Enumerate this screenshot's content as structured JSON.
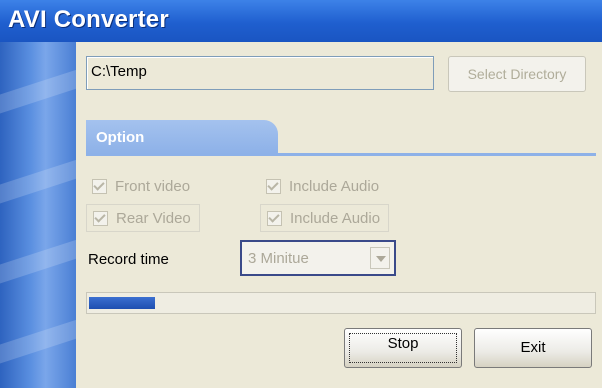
{
  "window": {
    "title": "AVI Converter"
  },
  "directory": {
    "value": "C:\\Temp",
    "select_label": "Select Directory"
  },
  "tab": {
    "label": "Option"
  },
  "options": {
    "front_video": {
      "label": "Front video",
      "checked": true,
      "enabled": false
    },
    "front_audio": {
      "label": "Include Audio",
      "checked": true,
      "enabled": false
    },
    "rear_video": {
      "label": "Rear Video",
      "checked": true,
      "enabled": false
    },
    "rear_audio": {
      "label": "Include Audio",
      "checked": true,
      "enabled": false
    }
  },
  "record_time": {
    "label": "Record time",
    "value": "3 Minitue"
  },
  "progress": {
    "fraction": 0.13
  },
  "buttons": {
    "stop": "Stop",
    "exit": "Exit"
  },
  "colors": {
    "titlebar": "#1f5fcf",
    "tab": "#8db1e8",
    "progress": "#1e4fb0",
    "background": "#ece9d8"
  }
}
